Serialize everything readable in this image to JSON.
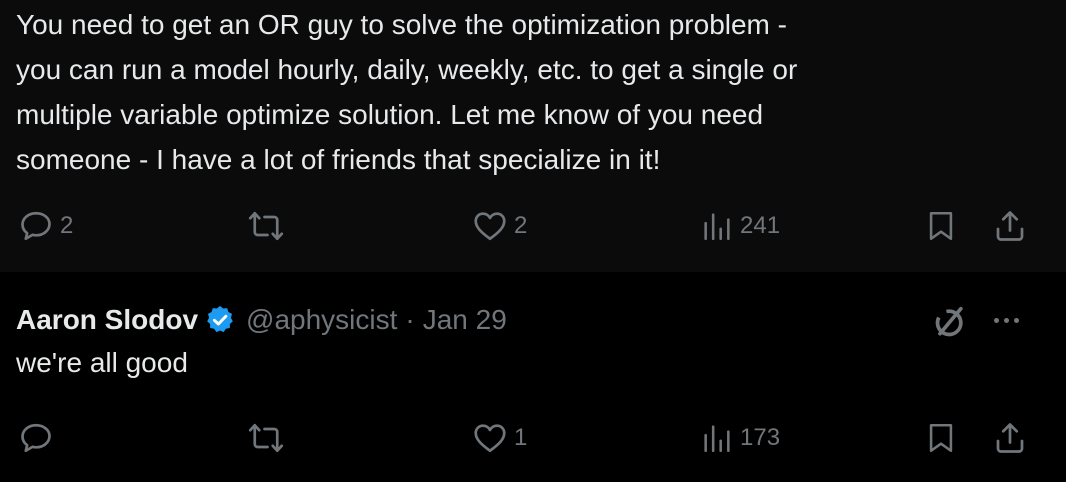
{
  "post1": {
    "lines": [
      "You need to get an OR guy to solve the optimization problem -",
      "you can run a model hourly, daily, weekly, etc. to get a single or",
      "multiple variable optimize solution. Let me know of you need",
      "someone - I have a lot of friends that specialize in it!"
    ],
    "replies": "2",
    "reposts": "",
    "likes": "2",
    "views": "241"
  },
  "post2": {
    "author_name": "Aaron Slodov",
    "handle": "@aphysicist",
    "separator": "·",
    "date": "Jan 29",
    "text": "we're all good",
    "replies": "",
    "reposts": "",
    "likes": "1",
    "views": "173"
  },
  "icons": {
    "reply": "reply-icon",
    "repost": "repost-icon",
    "like": "heart-icon",
    "views": "views-icon",
    "bookmark": "bookmark-icon",
    "share": "share-icon",
    "verified": "verified-badge-icon",
    "grok": "grok-icon",
    "more": "more-icon"
  },
  "colors": {
    "background": "#000000",
    "post_background": "#0b0b0c",
    "text": "#e7e9ea",
    "muted": "#71767b",
    "verified": "#1d9bf0"
  }
}
